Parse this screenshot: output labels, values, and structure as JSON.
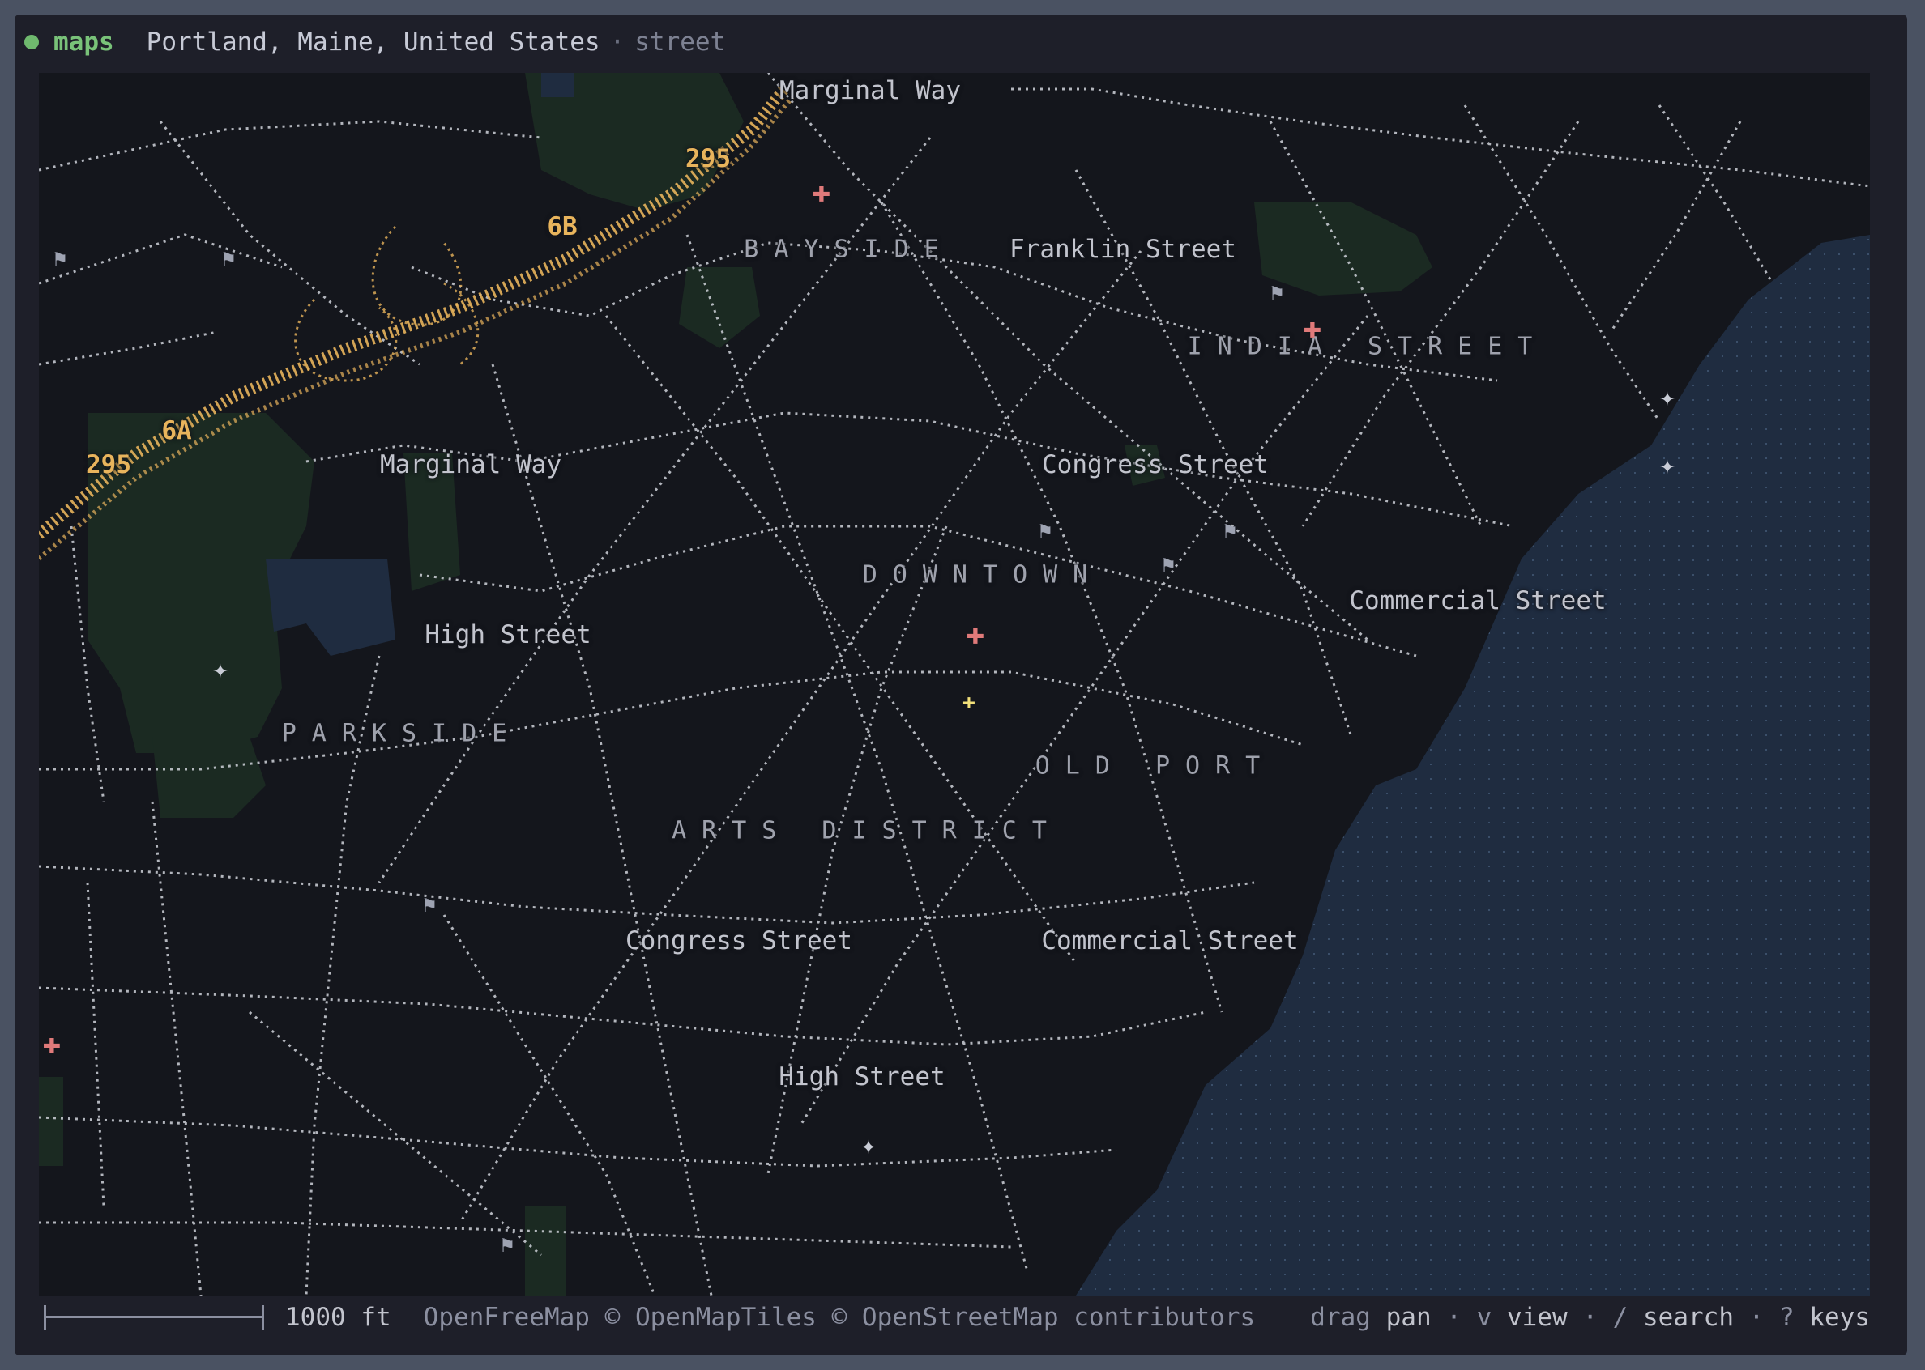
{
  "app": {
    "name": "maps",
    "status_color": "#6fb96e"
  },
  "location": {
    "place": "Portland, Maine, United States",
    "separator": "·",
    "view_mode": "street"
  },
  "colors": {
    "background": "#14161c",
    "water": "#1f2c40",
    "park": "#1b2a22",
    "street": "#cfd2da",
    "highway": "#e8b45c",
    "hospital": "#e07a7a"
  },
  "districts": [
    {
      "name": "BAYSIDE"
    },
    {
      "name": "INDIA STREET"
    },
    {
      "name": "DOWNTOWN"
    },
    {
      "name": "PARKSIDE"
    },
    {
      "name": "OLD PORT"
    },
    {
      "name": "ARTS DISTRICT"
    }
  ],
  "streets": [
    {
      "name": "Marginal Way"
    },
    {
      "name": "Franklin Street"
    },
    {
      "name": "Marginal Way"
    },
    {
      "name": "Congress Street"
    },
    {
      "name": "Commercial Street"
    },
    {
      "name": "High Street"
    },
    {
      "name": "Congress Street"
    },
    {
      "name": "Commercial Street"
    },
    {
      "name": "High Street"
    }
  ],
  "highway_shields": [
    {
      "name": "295"
    },
    {
      "name": "6B"
    },
    {
      "name": "6A"
    },
    {
      "name": "295"
    }
  ],
  "pois": {
    "hospital_icon": "✚",
    "flag_icon": "⚑",
    "star_icon": "✦",
    "center_icon": "+"
  },
  "footer": {
    "scale": "1000 ft",
    "attribution": "OpenFreeMap © OpenMapTiles © OpenStreetMap contributors",
    "keys": [
      {
        "key": "drag",
        "action": "pan"
      },
      {
        "key": "v",
        "action": "view"
      },
      {
        "key": "/",
        "action": "search"
      },
      {
        "key": "?",
        "action": "keys"
      }
    ],
    "separator": "·"
  }
}
